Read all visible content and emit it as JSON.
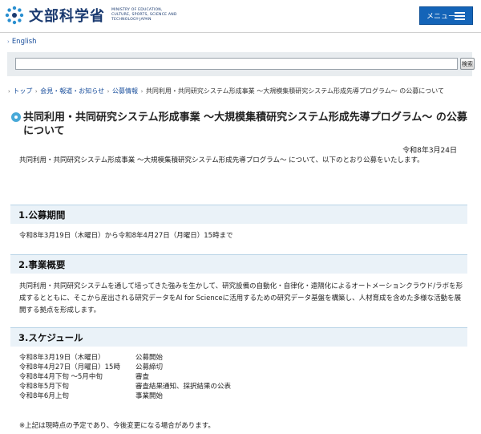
{
  "header": {
    "logo_text": "文部科学省",
    "logo_en": "MINISTRY OF EDUCATION, CULTURE, SPORTS, SCIENCE AND TECHNOLOGY-JAPAN",
    "menu_label": "メニュー"
  },
  "lang_link": "English",
  "search": {
    "button_label": "検索",
    "value": ""
  },
  "breadcrumb": [
    "トップ",
    "会見・報道・お知らせ",
    "公募情報",
    "共同利用・共同研究システム形成事業 〜大規模集積研究システム形成先導プログラム〜 の公募について"
  ],
  "page": {
    "title": "共同利用・共同研究システム形成事業 〜大規模集積研究システム形成先導プログラム〜 の公募について",
    "date": "令和8年3月24日",
    "intro": "共同利用・共同研究システム形成事業 〜大規模集積研究システム形成先導プログラム〜 について、以下のとおり公募をいたします。"
  },
  "sections": {
    "period": {
      "heading": "1.公募期間",
      "text": "令和8年3月19日（木曜日）から令和8年4月27日（月曜日）15時まで"
    },
    "overview": {
      "heading": "2.事業概要",
      "text": "共同利用・共同研究システムを通して培ってきた強みを生かして、研究設備の自動化・自律化・遠隔化によるオートメーションクラウド/ラボを形成するとともに、そこから産出される研究データをAI for Scienceに活用するための研究データ基盤を構築し、人材育成を含めた多様な活動を展開する拠点を形成します。"
    },
    "schedule": {
      "heading": "3.スケジュール",
      "rows": [
        {
          "date": "令和8年3月19日（木曜日）",
          "event": "公募開始"
        },
        {
          "date": "令和8年4月27日（月曜日）15時",
          "event": "公募締切"
        },
        {
          "date": "令和8年4月下旬 〜5月中旬",
          "event": "審査"
        },
        {
          "date": "令和8年5月下旬",
          "event": "審査結果通知、採択結果の公表"
        },
        {
          "date": "令和8年6月上旬",
          "event": "事業開始"
        }
      ],
      "note": "※上記は現時点の予定であり、今後変更になる場合があります。"
    }
  },
  "colors": {
    "accent": "#1464b8",
    "section_bg": "#eaf2f8",
    "link": "#1a4f9c",
    "bullet": "#48a9d8"
  }
}
